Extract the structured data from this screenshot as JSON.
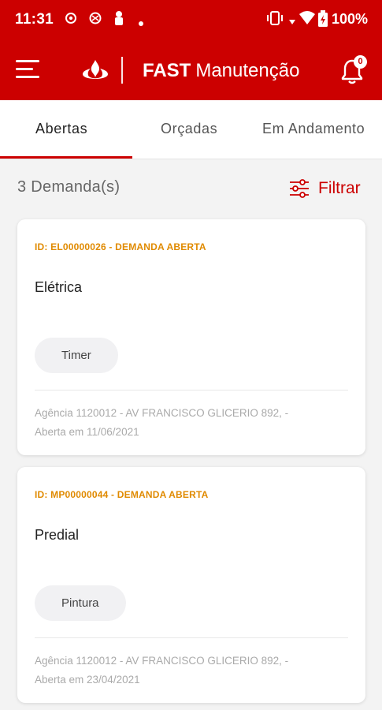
{
  "status_bar": {
    "time": "11:31",
    "battery": "100%",
    "icons": [
      "settings-notification-icon",
      "nfc-notification-icon",
      "profile-notification-icon",
      "dot-icon",
      "vibrate-icon",
      "wifi-icon",
      "battery-icon"
    ]
  },
  "app_bar": {
    "title_bold": "FAST",
    "title_rest": "Manutenção",
    "notification_count": "0",
    "logo": "flame-logo",
    "colors": {
      "brand": "#cc0000"
    }
  },
  "tabs": [
    {
      "label": "Abertas",
      "active": true
    },
    {
      "label": "Orçadas",
      "active": false
    },
    {
      "label": "Em Andamento",
      "active": false
    }
  ],
  "list": {
    "count_label": "3 Demanda(s)",
    "filter_label": "Filtrar"
  },
  "cards": [
    {
      "id_label": "ID: EL00000026 - DEMANDA ABERTA",
      "category": "Elétrica",
      "chip": "Timer",
      "address": "Agência 1120012 - AV FRANCISCO GLICERIO 892, -",
      "date": "Aberta em 11/06/2021"
    },
    {
      "id_label": "ID: MP00000044 - DEMANDA ABERTA",
      "category": "Predial",
      "chip": "Pintura",
      "address": "Agência 1120012 - AV FRANCISCO GLICERIO 892, -",
      "date": "Aberta em 23/04/2021"
    }
  ]
}
